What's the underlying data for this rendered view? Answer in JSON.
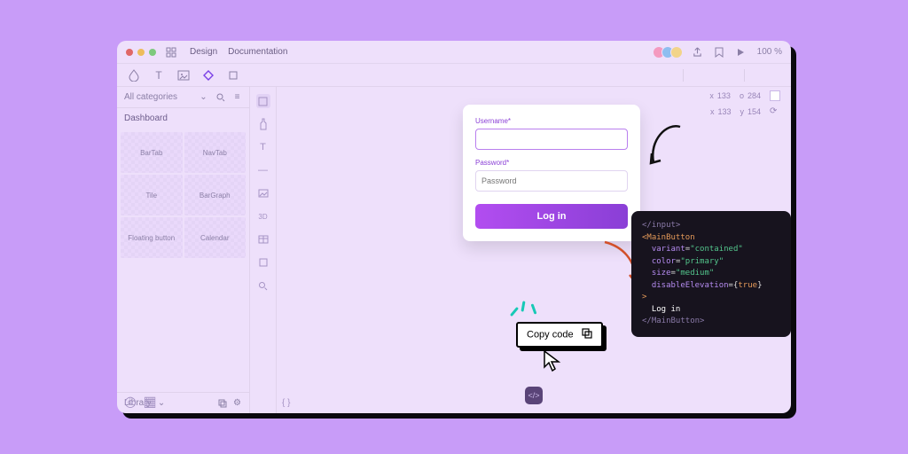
{
  "titlebar": {
    "tabs": [
      "Design",
      "Documentation"
    ],
    "zoom": "100 %"
  },
  "sidebar": {
    "category_label": "All categories",
    "section": "Dashboard",
    "items": [
      "BarTab",
      "NavTab",
      "Tile",
      "BarGraph",
      "Floating button",
      "Calendar"
    ],
    "footer_label": "Library"
  },
  "properties": {
    "x1_label": "x",
    "x1": "133",
    "y1_label": "o",
    "y1": "284",
    "x2_label": "x",
    "x2": "133",
    "y2_label": "y",
    "y2": "154"
  },
  "login": {
    "username_label": "Username*",
    "password_label": "Password*",
    "password_placeholder": "Password",
    "button_label": "Log in"
  },
  "code": {
    "top_close": "/input>",
    "open_tag": "MainButton",
    "attr1_name": "variant",
    "attr1_val": "contained",
    "attr2_name": "color",
    "attr2_val": "primary",
    "attr3_name": "size",
    "attr3_val": "medium",
    "attr4_name": "disableElevation",
    "attr4_bool": "true",
    "inner_text": "Log in",
    "close_tag": "MainButton"
  },
  "copy": {
    "label": "Copy code"
  }
}
